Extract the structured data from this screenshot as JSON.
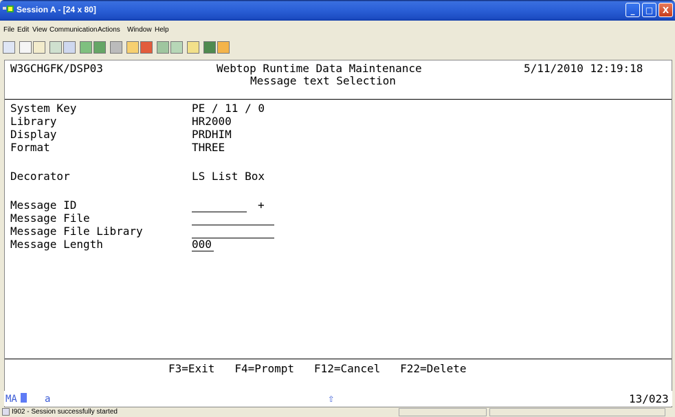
{
  "window": {
    "title": "Session A - [24 x 80]",
    "minimize": "_",
    "maximize": "□",
    "close": "X"
  },
  "menu": [
    "File",
    "Edit",
    "View",
    "Communication",
    "Actions",
    "Window",
    "Help"
  ],
  "toolbar": {
    "icons": [
      "connect-icon",
      "copy-icon",
      "paste-icon",
      "send-icon",
      "receive-icon",
      "display-icon",
      "display2-icon",
      "print-icon",
      "record-macro-icon",
      "stop-macro-icon",
      "play-macro-icon",
      "macro2-icon",
      "clipboard-icon",
      "color-icon",
      "keyboard-icon"
    ]
  },
  "screen": {
    "program": "W3GCHGFK/DSP03",
    "heading1": "Webtop Runtime Data Maintenance",
    "datetime": "5/11/2010 12:19:18",
    "heading2": "Message text Selection",
    "fields": [
      {
        "label": "System Key",
        "value": "PE / 11 / 0"
      },
      {
        "label": "Library",
        "value": "HR2000"
      },
      {
        "label": "Display",
        "value": "PRDHIM"
      },
      {
        "label": "Format",
        "value": "THREE"
      }
    ],
    "decorator_label": "Decorator",
    "decorator_value": "LS List Box",
    "message_id_label": "Message ID",
    "message_id_value": "",
    "message_id_prompt": "+",
    "message_file_label": "Message File",
    "message_file_value": "",
    "message_file_library_label": "Message File Library",
    "message_file_library_value": "",
    "message_length_label": "Message Length",
    "message_length_value": "000",
    "fkeys": "F3=Exit   F4=Prompt   F12=Cancel   F22=Delete"
  },
  "oia": {
    "ma": "MA",
    "a": "a",
    "shift": "⇧",
    "cursor": "13/023"
  },
  "status": {
    "code": "I902 - Session successfully started"
  }
}
